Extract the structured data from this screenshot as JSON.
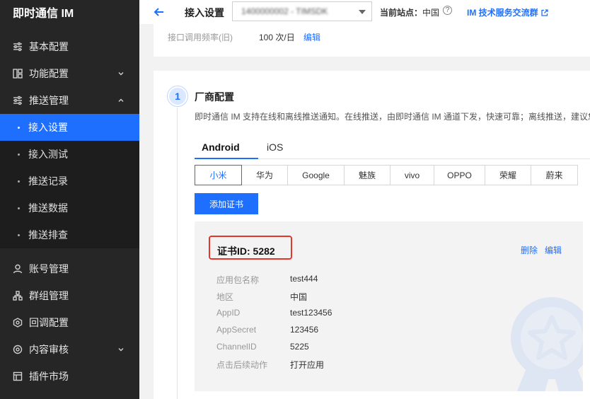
{
  "app": {
    "title": "即时通信 IM"
  },
  "sidebar": {
    "items": [
      {
        "label": "基本配置",
        "icon": "sliders-icon"
      },
      {
        "label": "功能配置",
        "icon": "grid-icon",
        "expandable": true
      },
      {
        "label": "推送管理",
        "icon": "sliders-icon",
        "expanded": true
      },
      {
        "label": "账号管理",
        "icon": "user-icon"
      },
      {
        "label": "群组管理",
        "icon": "group-icon"
      },
      {
        "label": "回调配置",
        "icon": "callback-icon"
      },
      {
        "label": "内容审核",
        "icon": "audit-icon",
        "expandable": true
      },
      {
        "label": "插件市场",
        "icon": "plugin-icon"
      }
    ],
    "push_sub": [
      {
        "label": "接入设置",
        "active": true
      },
      {
        "label": "接入测试"
      },
      {
        "label": "推送记录"
      },
      {
        "label": "推送数据"
      },
      {
        "label": "推送排查"
      }
    ]
  },
  "topbar": {
    "title": "接入设置",
    "app_select": "1400000002 - TIMSDK",
    "site_label": "当前站点：",
    "site_value": "中国",
    "help": "?",
    "link": "IM 技术服务交流群"
  },
  "card1": {
    "label": "接口调用频率(旧)",
    "value": "100 次/日",
    "edit": "编辑"
  },
  "vendor_config": {
    "step": "1",
    "title": "厂商配置",
    "desc": "即时通信 IM 支持在线和离线推送通知。在线推送，由即时通信 IM 通道下发，快速可靠；离线推送，建议您",
    "tabs": [
      "Android",
      "iOS"
    ],
    "vendors": [
      "小米",
      "华为",
      "Google",
      "魅族",
      "vivo",
      "OPPO",
      "荣耀",
      "蔚来"
    ],
    "add_button": "添加证书",
    "cert": {
      "id_label": "证书ID: 5282",
      "delete": "删除",
      "edit": "编辑",
      "fields": [
        {
          "key": "应用包名称",
          "value": "test444"
        },
        {
          "key": "地区",
          "value": "中国"
        },
        {
          "key": "AppID",
          "value": "test123456"
        },
        {
          "key": "AppSecret",
          "value": "123456"
        },
        {
          "key": "ChannelID",
          "value": "5225"
        },
        {
          "key": "点击后续动作",
          "value": "打开应用"
        }
      ]
    }
  },
  "colors": {
    "accent": "#1f6fff",
    "sidebar_bg": "#262626",
    "highlight_border": "#e5362b"
  }
}
